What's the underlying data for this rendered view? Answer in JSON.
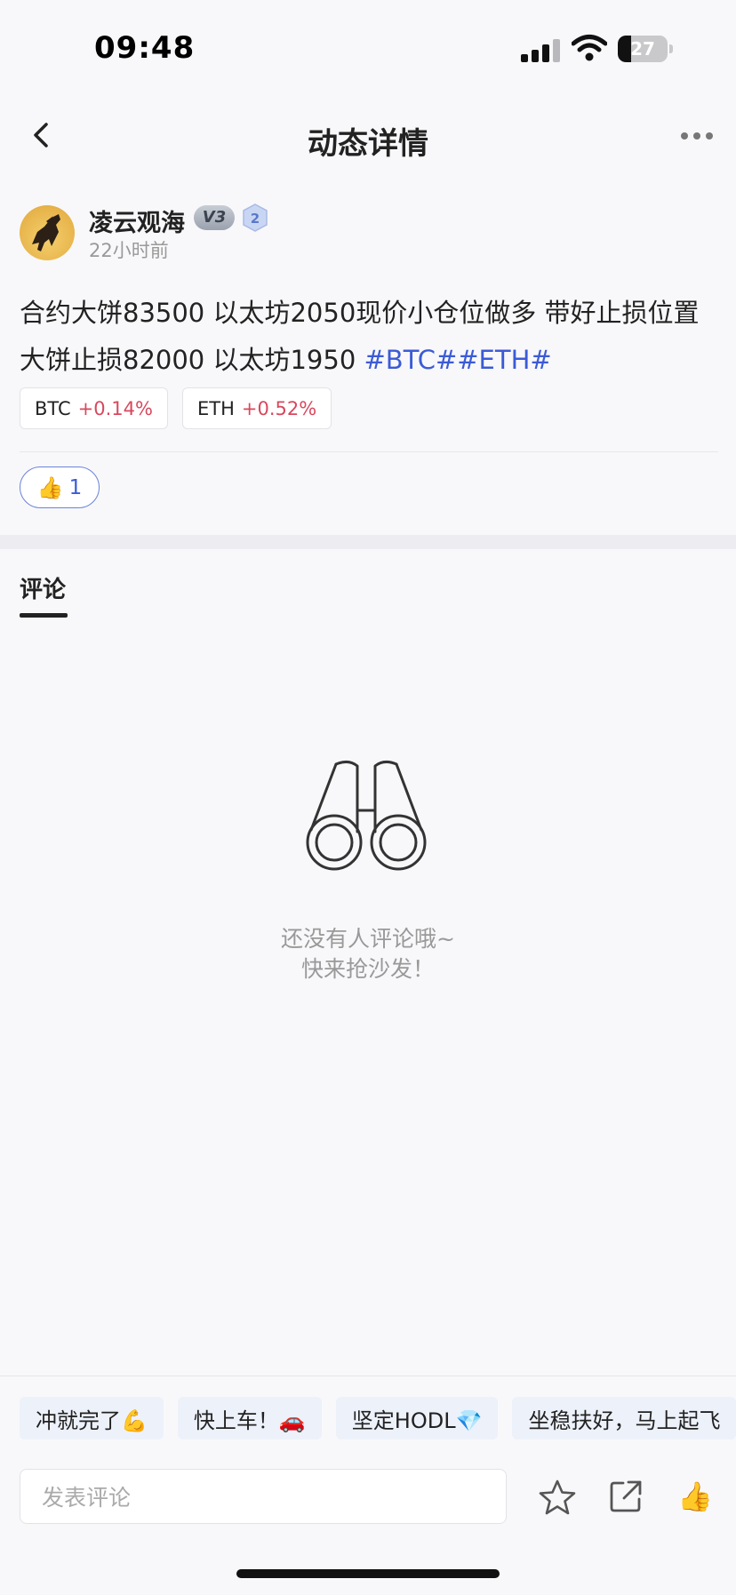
{
  "status_bar": {
    "time": "09:48",
    "battery": "27",
    "battery_level": 0.27
  },
  "nav": {
    "title": "动态详情"
  },
  "author": {
    "name": "凌云观海",
    "level": "V3",
    "rank": "2",
    "time": "22小时前"
  },
  "post": {
    "text": "合约大饼83500 以太坊2050现价小仓位做多 带好止损位置 大饼止损82000 以太坊1950 ",
    "hashtags": "#BTC##ETH#"
  },
  "tickers": [
    {
      "symbol": "BTC",
      "change": "+0.14%"
    },
    {
      "symbol": "ETH",
      "change": "+0.52%"
    }
  ],
  "like": {
    "icon": "👍",
    "count": "1"
  },
  "comments": {
    "tab": "评论",
    "empty_line1": "还没有人评论哦~",
    "empty_line2": "快来抢沙发！"
  },
  "quick_replies": [
    "冲就完了💪",
    "快上车！🚗",
    "坚定HODL💎",
    "坐稳扶好，马上起飞"
  ],
  "composer": {
    "placeholder": "发表评论",
    "like_icon": "👍"
  },
  "icons": [
    "back-icon",
    "more-icon",
    "binoculars-icon",
    "star-icon",
    "share-icon",
    "thumbs-up-icon"
  ],
  "colors": {
    "up": "#d8485d",
    "link": "#3b5bd6"
  }
}
